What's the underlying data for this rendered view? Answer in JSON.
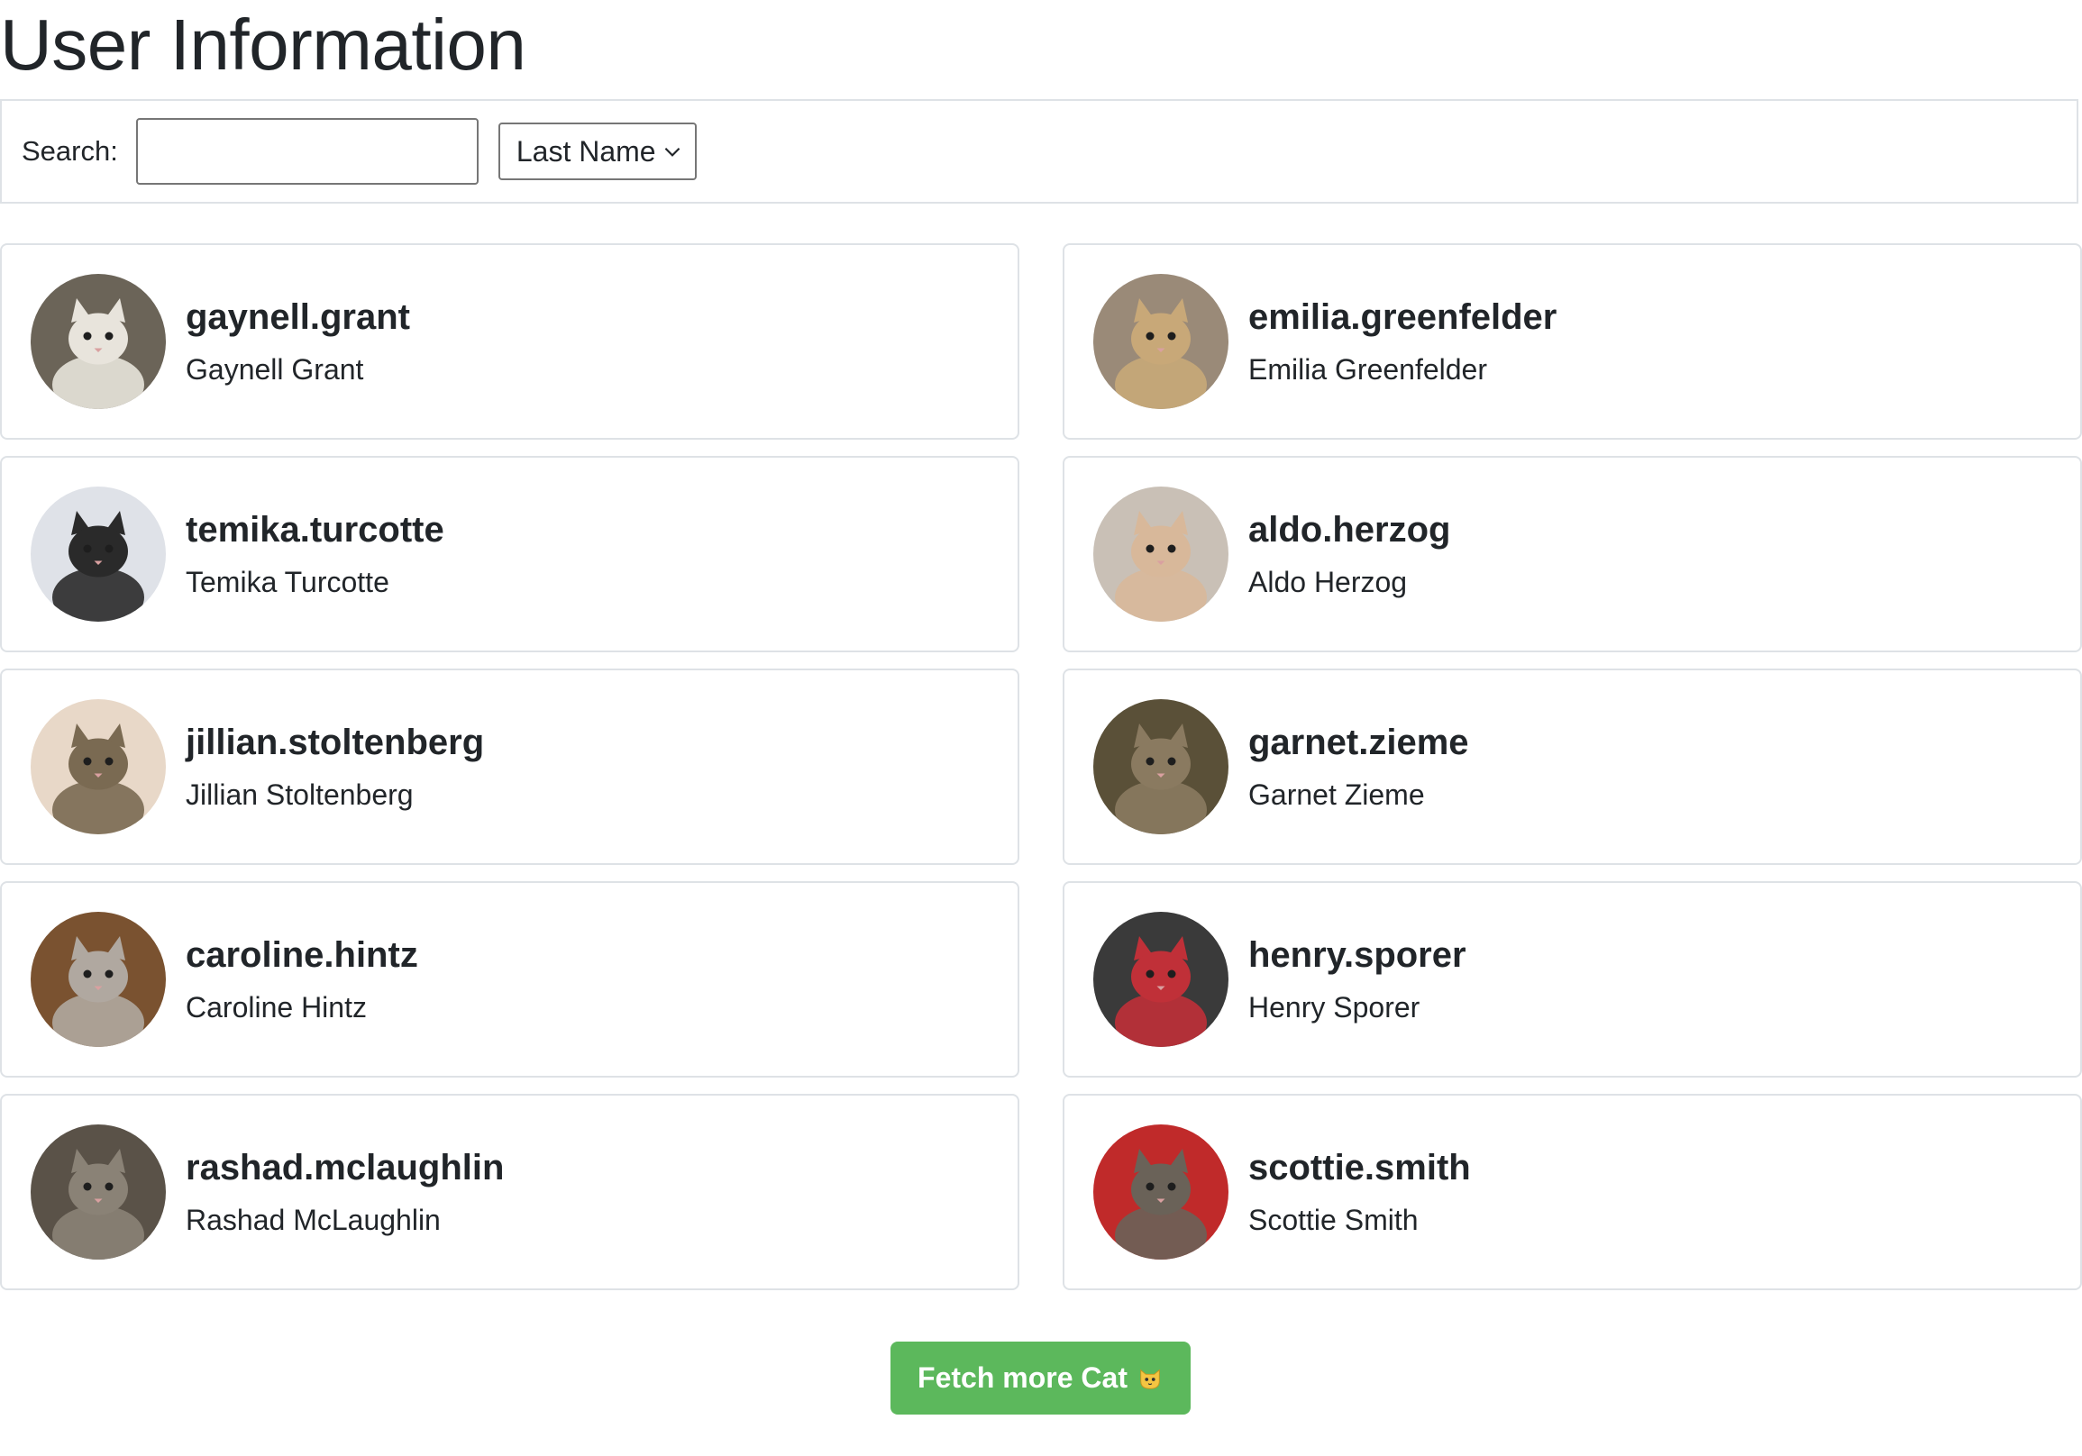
{
  "page": {
    "title": "User Information"
  },
  "search": {
    "label": "Search:",
    "value": "",
    "placeholder": ""
  },
  "sort": {
    "selected": "Last Name"
  },
  "users": [
    {
      "username": "gaynell.grant",
      "name": "Gaynell Grant"
    },
    {
      "username": "emilia.greenfelder",
      "name": "Emilia Greenfelder"
    },
    {
      "username": "temika.turcotte",
      "name": "Temika Turcotte"
    },
    {
      "username": "aldo.herzog",
      "name": "Aldo Herzog"
    },
    {
      "username": "jillian.stoltenberg",
      "name": "Jillian Stoltenberg"
    },
    {
      "username": "garnet.zieme",
      "name": "Garnet Zieme"
    },
    {
      "username": "caroline.hintz",
      "name": "Caroline Hintz"
    },
    {
      "username": "henry.sporer",
      "name": "Henry Sporer"
    },
    {
      "username": "rashad.mclaughlin",
      "name": "Rashad McLaughlin"
    },
    {
      "username": "scottie.smith",
      "name": "Scottie Smith"
    }
  ],
  "avatar_colors": [
    [
      "#6b6458",
      "#e8e4dc"
    ],
    [
      "#9a8a78",
      "#c8a878"
    ],
    [
      "#dfe2e8",
      "#2a2a2a"
    ],
    [
      "#c9c0b6",
      "#d8b89a"
    ],
    [
      "#e8d8c8",
      "#7a6a52"
    ],
    [
      "#5a5038",
      "#8a7a60"
    ],
    [
      "#7a5230",
      "#b0a8a0"
    ],
    [
      "#3a3a3a",
      "#c03038"
    ],
    [
      "#5a5248",
      "#8a8276"
    ],
    [
      "#c02a2a",
      "#6a6258"
    ]
  ],
  "fetch_button": {
    "label": "Fetch more Cat",
    "icon": "cat-face-icon",
    "color": "#5cb85c"
  }
}
